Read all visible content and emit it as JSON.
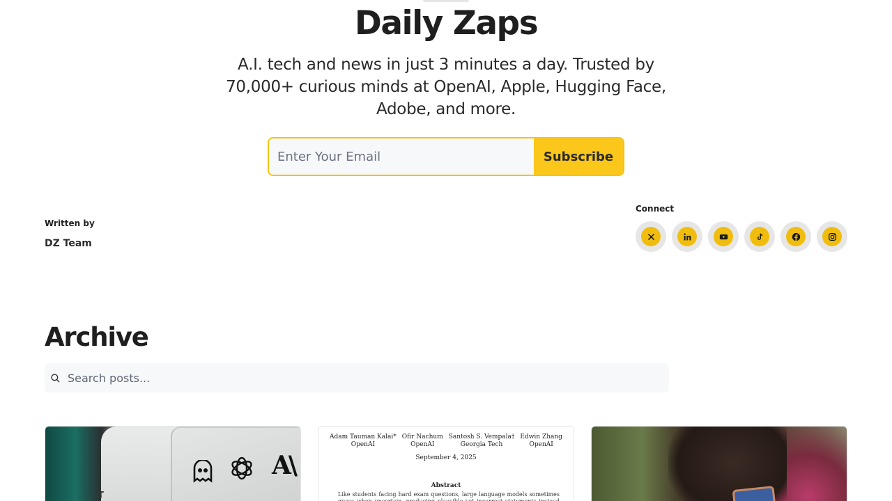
{
  "header": {
    "title": "Daily Zaps",
    "tagline": "A.I. tech and news in just 3 minutes a day. Trusted by 70,000+ curious minds at OpenAI, Apple, Hugging Face, Adobe, and more."
  },
  "subscribe": {
    "placeholder": "Enter Your Email",
    "button_label": "Subscribe",
    "accent_color": "#fbc71a"
  },
  "author": {
    "label": "Written by",
    "name": "DZ Team"
  },
  "connect": {
    "label": "Connect",
    "links": [
      {
        "icon": "x-icon"
      },
      {
        "icon": "linkedin-icon"
      },
      {
        "icon": "youtube-icon"
      },
      {
        "icon": "tiktok-icon"
      },
      {
        "icon": "facebook-icon"
      },
      {
        "icon": "instagram-icon"
      }
    ]
  },
  "archive": {
    "heading": "Archive",
    "search_placeholder": "Search posts..."
  },
  "posts": [
    {
      "image": "AI company logos on devices",
      "logo_text": "A\\",
      "caption_fragment": "T"
    },
    {
      "image": "research paper first page",
      "paper_authors": [
        {
          "name": "Adam Tauman Kalai*",
          "affiliation": "OpenAI"
        },
        {
          "name": "Ofir Nachum",
          "affiliation": "OpenAI"
        },
        {
          "name": "Santosh S. Vempala†",
          "affiliation": "Georgia Tech"
        },
        {
          "name": "Edwin Zhang",
          "affiliation": "OpenAI"
        }
      ],
      "paper_date": "September 4, 2025",
      "abstract_title": "Abstract",
      "abstract_text": "Like students facing hard exam questions, large language models sometimes guess when uncertain, producing plausible yet incorrect statements instead of admitting uncertainty. Such"
    },
    {
      "image": "person holding a smartphone"
    }
  ]
}
